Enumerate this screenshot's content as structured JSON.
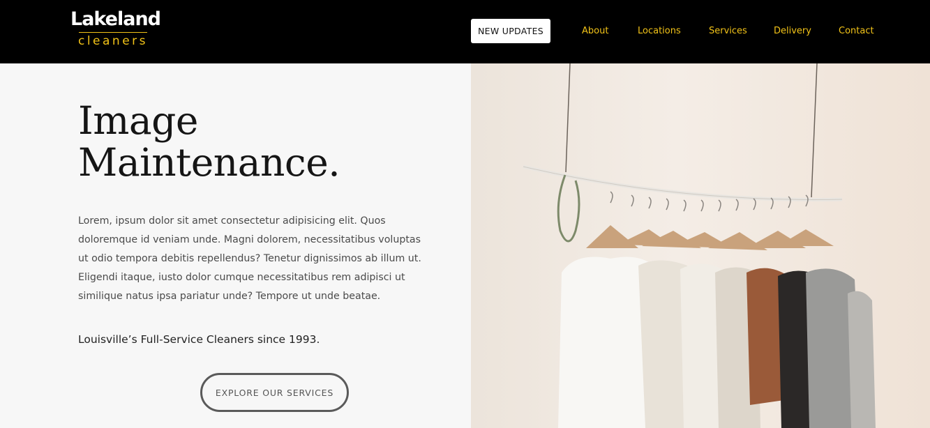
{
  "header": {
    "logo": {
      "main": "Lakeland",
      "sub": "cleaners"
    },
    "updates_button": "NEW UPDATES",
    "nav": [
      {
        "label": "About"
      },
      {
        "label": "Locations"
      },
      {
        "label": "Services"
      },
      {
        "label": "Delivery"
      },
      {
        "label": "Contact"
      }
    ]
  },
  "hero": {
    "headline_line1": "Image",
    "headline_line2": "Maintenance.",
    "body": "Lorem, ipsum dolor sit amet consectetur adipisicing elit. Quos doloremque id veniam unde. Magni dolorem, necessitatibus voluptas ut odio tempora debitis repellendus? Tenetur dignissimos ab illum ut. Eligendi itaque, iusto dolor cumque necessitatibus rem adipisci ut similique natus ipsa pariatur unde? Tempore ut unde beatae.",
    "tagline": "Louisville’s Full-Service Cleaners since 1993.",
    "cta": "EXPLORE OUR SERVICES"
  },
  "colors": {
    "header_bg": "#000000",
    "accent_yellow": "#f2c318",
    "page_bg": "#f7f7f7"
  }
}
